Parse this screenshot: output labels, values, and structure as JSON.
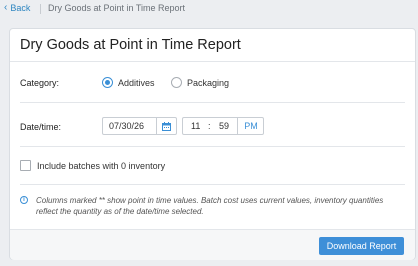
{
  "breadcrumb": {
    "back_label": "Back",
    "title": "Dry Goods at Point in Time Report"
  },
  "card": {
    "title": "Dry Goods at Point in Time Report"
  },
  "category": {
    "label": "Category:",
    "options": [
      {
        "label": "Additives",
        "selected": true
      },
      {
        "label": "Packaging",
        "selected": false
      }
    ]
  },
  "datetime": {
    "label": "Date/time:",
    "date_value": "07/30/26",
    "hour": "11",
    "separator": ":",
    "minute": "59",
    "ampm": "PM"
  },
  "include_zero": {
    "label": "Include batches with 0 inventory",
    "checked": false
  },
  "info": {
    "text": "Columns marked ** show point in time values. Batch cost uses current values, inventory quantities reflect the quantity as of the date/time selected."
  },
  "footer": {
    "download_label": "Download Report"
  },
  "colors": {
    "accent": "#3e8fd8",
    "link": "#2e86c1"
  }
}
